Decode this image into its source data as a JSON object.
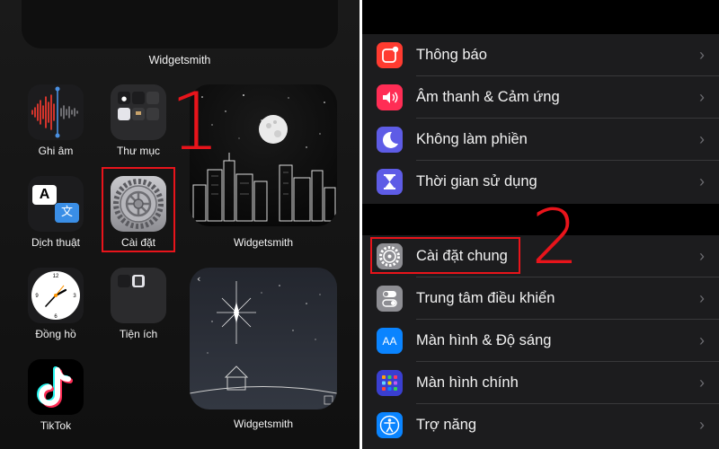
{
  "home_screen": {
    "top_widget_label": "Widgetsmith",
    "apps": [
      {
        "label": "Ghi âm",
        "icon": "voice-memos-icon"
      },
      {
        "label": "Thư mục",
        "icon": "folder-icon"
      },
      {
        "label": "Dịch thuật",
        "icon": "translate-icon"
      },
      {
        "label": "Cài đặt",
        "icon": "settings-gear-icon"
      },
      {
        "label": "Đồng hồ",
        "icon": "clock-icon"
      },
      {
        "label": "Tiện ích",
        "icon": "utilities-folder-icon"
      },
      {
        "label": "TikTok",
        "icon": "tiktok-icon"
      }
    ],
    "widgets": [
      {
        "label": "Widgetsmith"
      },
      {
        "label": "Widgetsmith"
      }
    ],
    "translate_glyphs": {
      "latin": "A",
      "cjk": "文"
    },
    "step_number": "1"
  },
  "settings": {
    "group1": [
      {
        "label": "Thông báo",
        "icon": "notifications-icon",
        "color": "#ff3b30"
      },
      {
        "label": "Âm thanh & Cảm ứng",
        "icon": "sound-icon",
        "color": "#ff2d55"
      },
      {
        "label": "Không làm phiền",
        "icon": "moon-icon",
        "color": "#5e5ce6"
      },
      {
        "label": "Thời gian sử dụng",
        "icon": "hourglass-icon",
        "color": "#5e5ce6"
      }
    ],
    "group2": [
      {
        "label": "Cài đặt chung",
        "icon": "gear-icon",
        "color": "#8e8e93"
      },
      {
        "label": "Trung tâm điều khiển",
        "icon": "toggles-icon",
        "color": "#8e8e93"
      },
      {
        "label": "Màn hình & Độ sáng",
        "icon": "display-icon",
        "color": "#0a84ff",
        "glyph": "AA"
      },
      {
        "label": "Màn hình chính",
        "icon": "home-grid-icon",
        "color": "#3a3fd0"
      },
      {
        "label": "Trợ năng",
        "icon": "accessibility-icon",
        "color": "#0a84ff"
      }
    ],
    "chevron": "›",
    "step_number": "2"
  },
  "colors": {
    "highlight": "#e8141b"
  }
}
